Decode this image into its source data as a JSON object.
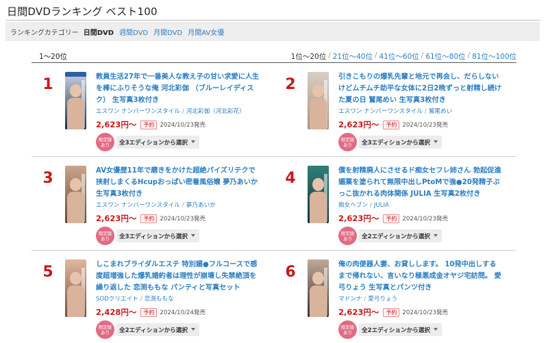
{
  "page": {
    "title": "日間DVDランキング ベスト100"
  },
  "categories": {
    "label": "ランキングカテゴリー",
    "items": [
      {
        "label": "日間DVD",
        "active": true
      },
      {
        "label": "週間DVD",
        "active": false
      },
      {
        "label": "月間DVD",
        "active": false
      },
      {
        "label": "月間AV女優",
        "active": false
      }
    ]
  },
  "range": {
    "current": "1〜20位"
  },
  "pager": {
    "items": [
      "1位〜20位",
      "21位〜40位",
      "41位〜60位",
      "61位〜80位",
      "81位〜100位"
    ]
  },
  "products": [
    {
      "rank": "1",
      "title": "教員生活27年で一番美人な教え子の甘い求愛に人生を棒にふりそうな俺 河北彩伽 （ブルーレイディスク） 生写真3枚付き",
      "maker": "エスワン ナンバーワンスタイル",
      "actress": "河北彩伽（河北彩花）",
      "price": "2,623円〜",
      "yoyaku": "予約",
      "release": "2024/10/23発売",
      "limited": "限定版あり",
      "select": "全3エディションから選択",
      "thumb_colors": [
        "#c9d6e6",
        "#1f2b45"
      ]
    },
    {
      "rank": "2",
      "title": "引きこもりの爆乳先輩と地元で再会し、だらしないけどムチムチ助平な女体に2日2晩ずっと射精し続けた夏の日 鷲尾めい 生写真3枚付き",
      "maker": "エスワン ナンバーワンスタイル",
      "actress": "鷲尾めい",
      "price": "2,623円〜",
      "yoyaku": "予約",
      "release": "2024/10/23発売",
      "limited": "限定版あり",
      "select": "全3エディションから選択",
      "thumb_colors": [
        "#d8cfc4",
        "#a98f7c"
      ]
    },
    {
      "rank": "3",
      "title": "AV女優歴11年で磨きをかけた超絶パイズリテクで挟射しまくるHcupおっぱい密着風俗嬢 夢乃あいか 生写真3枚付き",
      "maker": "エスワン ナンバーワンスタイル",
      "actress": "夢乃あいか",
      "price": "2,623円〜",
      "yoyaku": "予約",
      "release": "2024/10/23発売",
      "limited": "限定版あり",
      "select": "全3エディションから選択",
      "thumb_colors": [
        "#caa58c",
        "#6b4534"
      ]
    },
    {
      "rank": "4",
      "title": "僕を射精廃人にさせるド痴女セフレ姉さん 勃起促進媚薬を塗られて無限中出しPtoMで強●20発精子ぶっこ抜かれる肉体関係 JULIA 生写真2枚付き",
      "maker": "痴女ヘブン",
      "actress": "JULIA",
      "price": "2,623円〜",
      "yoyaku": "予約",
      "release": "2024/10/23発売",
      "limited": "限定版あり",
      "select": "全2エディションから選択",
      "thumb_colors": [
        "#2e7f7a",
        "#16323a"
      ]
    },
    {
      "rank": "5",
      "title": "しこまれブライダルエステ 特別媚●フルコースで感度超増強した爆乳婚約者は理性が崩壊し失禁絶頂を繰り返した 恋渕ももな パンティと写真セット",
      "maker": "SODクリエイト",
      "actress": "恋渕ももな",
      "price": "2,428円〜",
      "yoyaku": "予約",
      "release": "2024/10/24発売",
      "limited": "限定版あり",
      "select": "全2エディションから選択",
      "thumb_colors": [
        "#e1b79e",
        "#7a4b39"
      ]
    },
    {
      "rank": "6",
      "title": "俺の肉便器人妻、お貸しします。 10発中出しするまで帰れない、言いなり極悪成金オヤジ宅訪問。 愛弓りょう 生写真とパンツ付き",
      "maker": "マドンナ",
      "actress": "愛弓りょう",
      "price": "2,623円〜",
      "yoyaku": "予約",
      "release": "2024/10/23発売",
      "limited": "限定版あり",
      "select": "全2エディションから選択",
      "thumb_colors": [
        "#bfa898",
        "#3b3330"
      ]
    }
  ]
}
